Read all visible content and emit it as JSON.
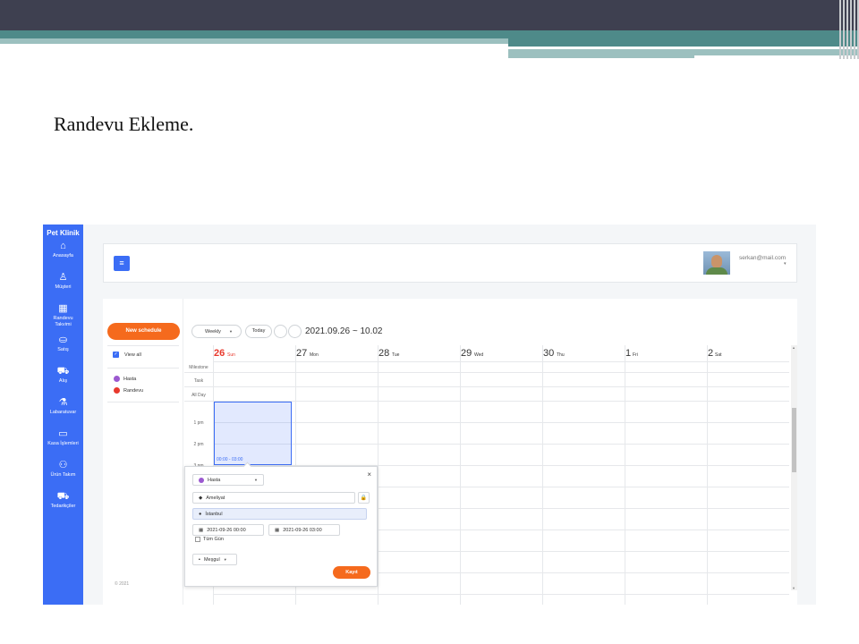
{
  "slide": {
    "title": "Randevu Ekleme."
  },
  "app": {
    "brand": "Pet Klinik",
    "sidebar": {
      "items": [
        {
          "label": "Anasayfa",
          "icon": "home-icon",
          "glyph": "⌂"
        },
        {
          "label": "Müşteri",
          "icon": "user-icon",
          "glyph": "♙"
        },
        {
          "label": "Randevu Takvimi",
          "icon": "calendar-icon",
          "glyph": "▦"
        },
        {
          "label": "Satış",
          "icon": "basket-icon",
          "glyph": "⛀"
        },
        {
          "label": "Alış",
          "icon": "truck-icon",
          "glyph": "⛟"
        },
        {
          "label": "Labaratuvar",
          "icon": "flask-icon",
          "glyph": "⚗"
        },
        {
          "label": "Kasa İşlemleri",
          "icon": "cash-icon",
          "glyph": "▭"
        },
        {
          "label": "Ürün Takım",
          "icon": "people-icon",
          "glyph": "⚇"
        },
        {
          "label": "Tedarikçiler",
          "icon": "truck-icon",
          "glyph": "⛟"
        }
      ]
    },
    "header": {
      "menu_glyph": "≡",
      "user_email": "serkan@mail.com",
      "caret": "▾"
    },
    "calendar": {
      "new_schedule_label": "New schedule",
      "view_all_label": "View all",
      "calendars": [
        {
          "name": "Hasta",
          "color": "#9b59d0"
        },
        {
          "name": "Randevu",
          "color": "#e8392d"
        }
      ],
      "view_select": "Weekly",
      "today_label": "Today",
      "range": "2021.09.26 ~ 10.02",
      "days": [
        {
          "num": "26",
          "name": "Sun",
          "color": "#e8392d"
        },
        {
          "num": "27",
          "name": "Mon",
          "color": "#333333"
        },
        {
          "num": "28",
          "name": "Tue",
          "color": "#333333"
        },
        {
          "num": "29",
          "name": "Wed",
          "color": "#333333"
        },
        {
          "num": "30",
          "name": "Thu",
          "color": "#333333"
        },
        {
          "num": "1",
          "name": "Fri",
          "color": "#333333"
        },
        {
          "num": "2",
          "name": "Sat",
          "color": "#333333"
        }
      ],
      "row_labels": [
        "Milestone",
        "Task",
        "All Day"
      ],
      "hour_labels": [
        "1 pm",
        "2 pm",
        "3 pm"
      ],
      "selection_label": "00:00 - 03:00",
      "copyright": "© 2021"
    },
    "popup": {
      "calendar_select": "Hasta",
      "title_value": "Ameliyat",
      "location_value": "İstanbul",
      "start_date": "2021-09-26 00:00",
      "end_date": "2021-09-26 03:00",
      "all_day_label": "Tüm Gün",
      "state_select": "Meşgul",
      "save_label": "Kayıt",
      "close_glyph": "×"
    }
  }
}
